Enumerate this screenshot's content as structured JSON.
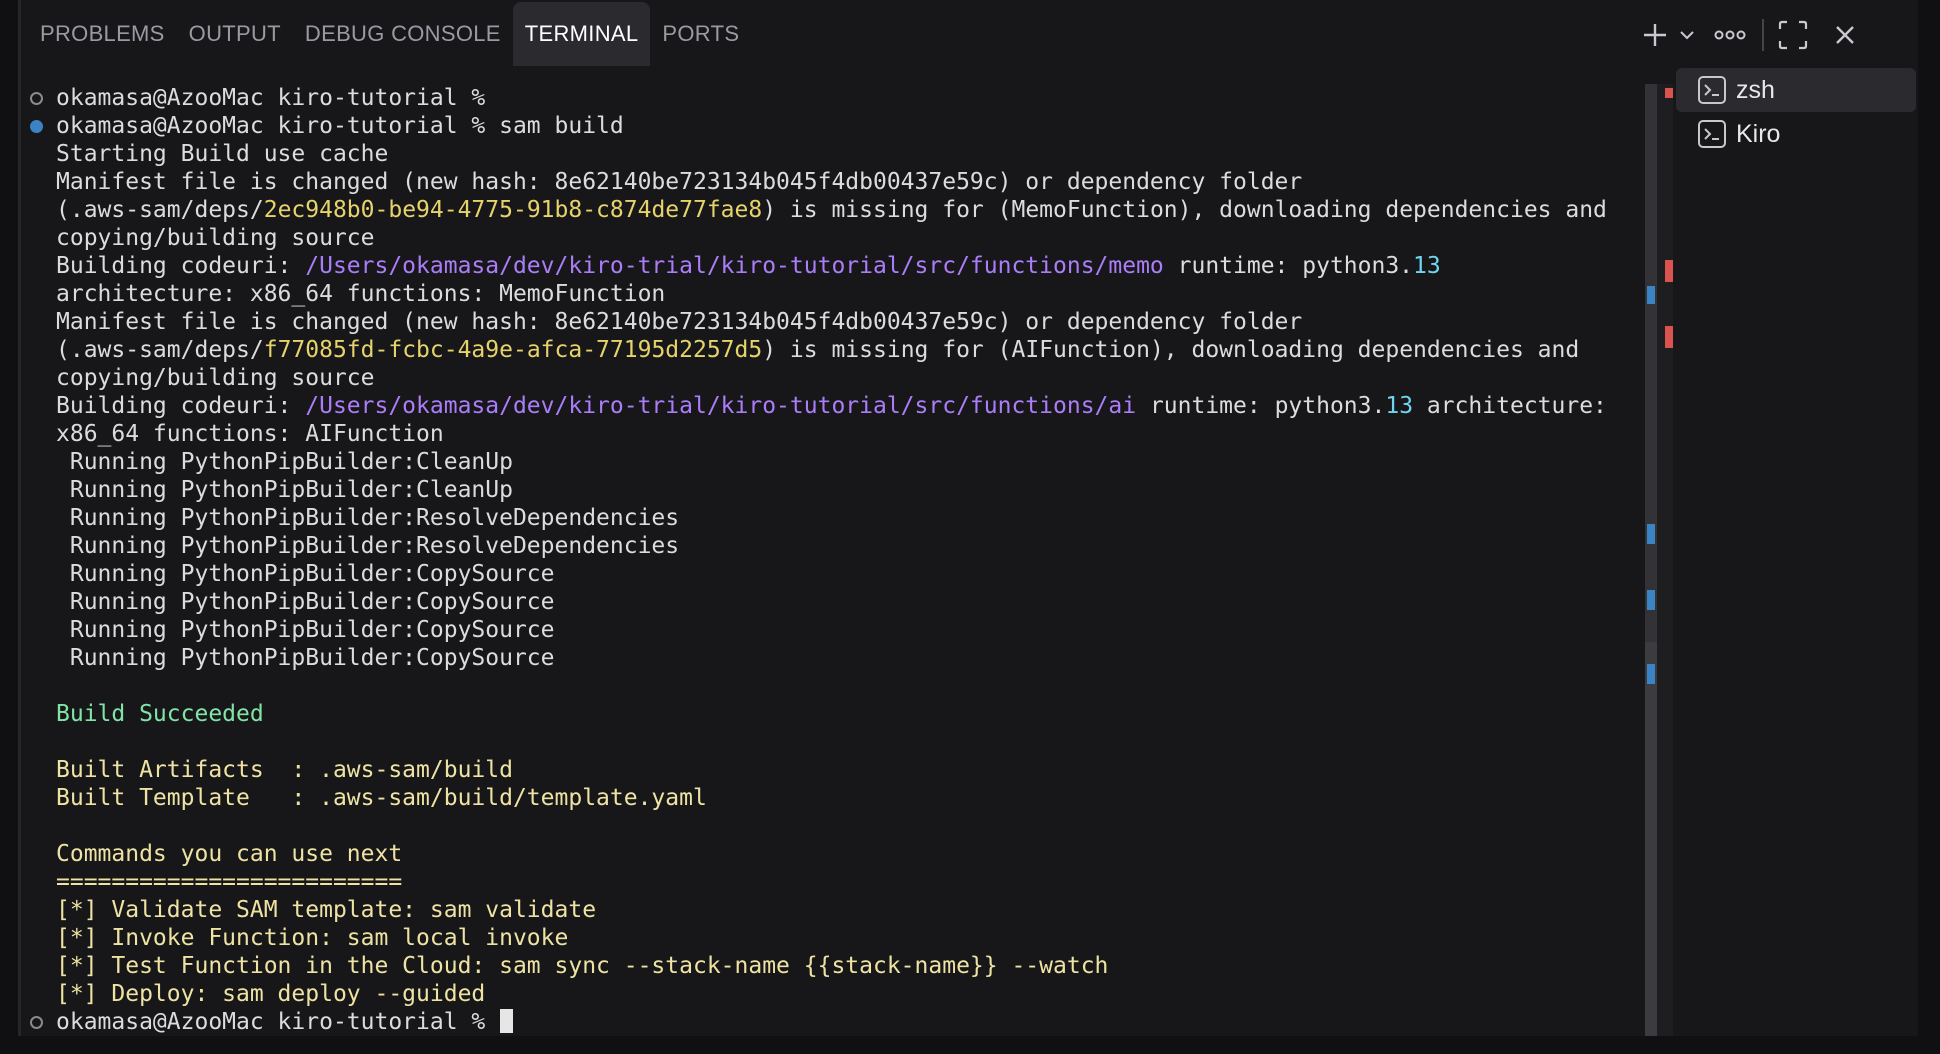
{
  "tabs": [
    {
      "label": "PROBLEMS",
      "active": false
    },
    {
      "label": "OUTPUT",
      "active": false
    },
    {
      "label": "DEBUG CONSOLE",
      "active": false
    },
    {
      "label": "TERMINAL",
      "active": true
    },
    {
      "label": "PORTS",
      "active": false
    }
  ],
  "actions": [
    "new-terminal-icon",
    "launch-profile-chevron-icon",
    "more-actions-icon",
    "maximize-panel-icon",
    "close-panel-icon"
  ],
  "terminals": [
    {
      "label": "zsh",
      "selected": true
    },
    {
      "label": "Kiro",
      "selected": false
    }
  ],
  "colors": {
    "path": "#ab7df8",
    "hash": "#e6d36a",
    "number": "#6fd6ef",
    "success": "#82e3a6",
    "info": "#eee3a3",
    "ruler_red": "#d9534f",
    "ruler_blue": "#3a84c6"
  },
  "lines": [
    {
      "mark": "empty",
      "segments": [
        {
          "t": "okamasa@AzooMac kiro-tutorial % ",
          "c": ""
        }
      ]
    },
    {
      "mark": "blue",
      "segments": [
        {
          "t": "okamasa@AzooMac kiro-tutorial % sam build",
          "c": ""
        }
      ]
    },
    {
      "mark": "",
      "segments": [
        {
          "t": "Starting Build use cache",
          "c": ""
        }
      ]
    },
    {
      "mark": "",
      "segments": [
        {
          "t": "Manifest file is changed (new hash: 8e62140be723134b045f4db00437e59c) or dependency folder",
          "c": ""
        }
      ]
    },
    {
      "mark": "",
      "segments": [
        {
          "t": "(.aws-sam/deps/",
          "c": ""
        },
        {
          "t": "2ec948b0-be94-4775-91b8-c874de77fae8",
          "c": "hash"
        },
        {
          "t": ") is missing for (MemoFunction), downloading dependencies and",
          "c": ""
        }
      ]
    },
    {
      "mark": "",
      "segments": [
        {
          "t": "copying/building source",
          "c": ""
        }
      ]
    },
    {
      "mark": "",
      "segments": [
        {
          "t": "Building codeuri: ",
          "c": ""
        },
        {
          "t": "/Users/okamasa/dev/kiro-trial/kiro-tutorial/src/functions/memo",
          "c": "path"
        },
        {
          "t": " runtime: python3.",
          "c": ""
        },
        {
          "t": "13",
          "c": "num"
        }
      ]
    },
    {
      "mark": "",
      "segments": [
        {
          "t": "architecture: x86_64 functions: MemoFunction",
          "c": ""
        }
      ]
    },
    {
      "mark": "",
      "segments": [
        {
          "t": "Manifest file is changed (new hash: 8e62140be723134b045f4db00437e59c) or dependency folder",
          "c": ""
        }
      ]
    },
    {
      "mark": "",
      "segments": [
        {
          "t": "(.aws-sam/deps/",
          "c": ""
        },
        {
          "t": "f77085fd-fcbc-4a9e-afca-77195d2257d5",
          "c": "hash"
        },
        {
          "t": ") is missing for (AIFunction), downloading dependencies and",
          "c": ""
        }
      ]
    },
    {
      "mark": "",
      "segments": [
        {
          "t": "copying/building source",
          "c": ""
        }
      ]
    },
    {
      "mark": "",
      "segments": [
        {
          "t": "Building codeuri: ",
          "c": ""
        },
        {
          "t": "/Users/okamasa/dev/kiro-trial/kiro-tutorial/src/functions/ai",
          "c": "path"
        },
        {
          "t": " runtime: python3.",
          "c": ""
        },
        {
          "t": "13",
          "c": "num"
        },
        {
          "t": " architecture:",
          "c": ""
        }
      ]
    },
    {
      "mark": "",
      "segments": [
        {
          "t": "x86_64 functions: AIFunction",
          "c": ""
        }
      ]
    },
    {
      "mark": "",
      "segments": [
        {
          "t": " Running PythonPipBuilder:CleanUp",
          "c": ""
        }
      ]
    },
    {
      "mark": "",
      "segments": [
        {
          "t": " Running PythonPipBuilder:CleanUp",
          "c": ""
        }
      ]
    },
    {
      "mark": "",
      "segments": [
        {
          "t": " Running PythonPipBuilder:ResolveDependencies",
          "c": ""
        }
      ]
    },
    {
      "mark": "",
      "segments": [
        {
          "t": " Running PythonPipBuilder:ResolveDependencies",
          "c": ""
        }
      ]
    },
    {
      "mark": "",
      "segments": [
        {
          "t": " Running PythonPipBuilder:CopySource",
          "c": ""
        }
      ]
    },
    {
      "mark": "",
      "segments": [
        {
          "t": " Running PythonPipBuilder:CopySource",
          "c": ""
        }
      ]
    },
    {
      "mark": "",
      "segments": [
        {
          "t": " Running PythonPipBuilder:CopySource",
          "c": ""
        }
      ]
    },
    {
      "mark": "",
      "segments": [
        {
          "t": " Running PythonPipBuilder:CopySource",
          "c": ""
        }
      ]
    },
    {
      "mark": "",
      "segments": [
        {
          "t": "",
          "c": ""
        }
      ]
    },
    {
      "mark": "",
      "segments": [
        {
          "t": "Build Succeeded",
          "c": "green"
        }
      ]
    },
    {
      "mark": "",
      "segments": [
        {
          "t": "",
          "c": ""
        }
      ]
    },
    {
      "mark": "",
      "segments": [
        {
          "t": "Built Artifacts  : .aws-sam/build",
          "c": "yellow"
        }
      ]
    },
    {
      "mark": "",
      "segments": [
        {
          "t": "Built Template   : .aws-sam/build/template.yaml",
          "c": "yellow"
        }
      ]
    },
    {
      "mark": "",
      "segments": [
        {
          "t": "",
          "c": ""
        }
      ]
    },
    {
      "mark": "",
      "segments": [
        {
          "t": "Commands you can use next",
          "c": "yellow"
        }
      ]
    },
    {
      "mark": "",
      "segments": [
        {
          "t": "=========================",
          "c": "yellow"
        }
      ]
    },
    {
      "mark": "",
      "segments": [
        {
          "t": "[*] Validate SAM template: sam validate",
          "c": "yellow"
        }
      ]
    },
    {
      "mark": "",
      "segments": [
        {
          "t": "[*] Invoke Function: sam local invoke",
          "c": "yellow"
        }
      ]
    },
    {
      "mark": "",
      "segments": [
        {
          "t": "[*] Test Function in the Cloud: sam sync --stack-name {{stack-name}} --watch",
          "c": "yellow"
        }
      ]
    },
    {
      "mark": "",
      "segments": [
        {
          "t": "[*] Deploy: sam deploy --guided",
          "c": "yellow"
        }
      ]
    },
    {
      "mark": "empty",
      "segments": [
        {
          "t": "okamasa@AzooMac kiro-tutorial % ",
          "c": ""
        }
      ],
      "cursor": true
    }
  ]
}
